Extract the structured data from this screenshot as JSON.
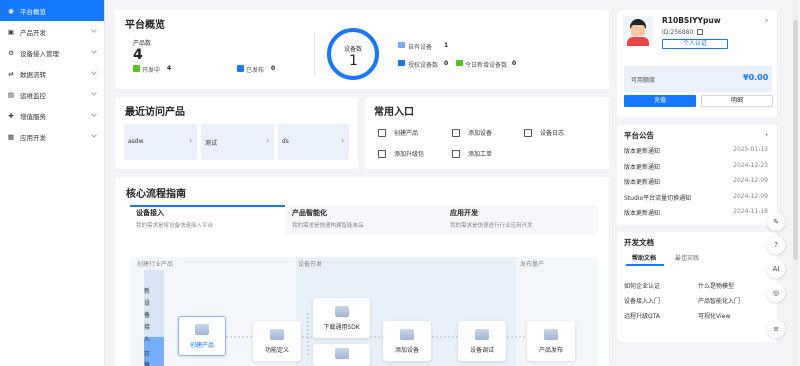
{
  "sidebar": {
    "items": [
      {
        "label": "平台概览",
        "active": true,
        "icon": "home-icon"
      },
      {
        "label": "产品开发",
        "icon": "product-icon"
      },
      {
        "label": "设备接入管理",
        "icon": "device-icon"
      },
      {
        "label": "数据流转",
        "icon": "data-flow-icon"
      },
      {
        "label": "运维监控",
        "icon": "monitor-icon"
      },
      {
        "label": "增值服务",
        "icon": "service-icon"
      },
      {
        "label": "应用开发",
        "icon": "app-icon"
      }
    ]
  },
  "overview": {
    "title": "平台概览",
    "product_count_label": "产品数",
    "product_count": "4",
    "developing_label": "开发中",
    "developing_count": "4",
    "published_label": "已发布",
    "published_count": "0",
    "device_count_label": "设备数",
    "device_count": "1",
    "own_devices_label": "自有设备",
    "own_devices": "1",
    "authorized_label": "授权设备数",
    "authorized": "0",
    "new_today_label": "今日新增设备数",
    "new_today": "0"
  },
  "account": {
    "username": "R10BSIYYpuw",
    "id_text": "ID:256880",
    "personal_cert": "个人认证",
    "quota_label": "可用额度",
    "quota": "¥0.00",
    "recharge": "充值",
    "details": "明细"
  },
  "recent": {
    "title": "最近访问产品",
    "items": [
      "asdw",
      "测试",
      "ds"
    ]
  },
  "shortcuts": {
    "title": "常用入口",
    "items": [
      "创建产品",
      "添加设备",
      "设备日志",
      "添加升级包",
      "添加工单"
    ]
  },
  "announcements": {
    "title": "平台公告",
    "items": [
      {
        "text": "版本更新通知",
        "date": "2025-01-13"
      },
      {
        "text": "版本更新通知",
        "date": "2024-12-23"
      },
      {
        "text": "版本更新通知",
        "date": "2024-12-09"
      },
      {
        "text": "Studio平台流量切换通知",
        "date": "2024-12-09"
      },
      {
        "text": "版本更新通知",
        "date": "2024-11-18"
      }
    ]
  },
  "docs": {
    "title": "开发文档",
    "tabs": [
      "帮助文档",
      "最佳实践"
    ],
    "links": [
      "如何企业认证",
      "什么是物模型",
      "设备接入入门",
      "产品智能化入门",
      "远程升级OTA",
      "可视化View"
    ]
  },
  "guide": {
    "title": "核心流程指南",
    "tabs": [
      {
        "label": "设备接入",
        "sub": "我的需求是将设备快速接入平台"
      },
      {
        "label": "产品智能化",
        "sub": "我的需求是快速构建智能单品"
      },
      {
        "label": "应用开发",
        "sub": "我的需求是快速进行行业应用开发"
      }
    ],
    "stages": [
      "创建行业产品",
      "设备开发",
      "发布量产"
    ],
    "vertical_label": "新设备接入",
    "vertical_label2": "存量",
    "nodes": [
      "创建产品",
      "功能定义",
      "下载通用SDK",
      "添加设备",
      "设备调试",
      "产品发布"
    ]
  },
  "float": [
    "AI"
  ],
  "colors": {
    "accent": "#1677ff",
    "green": "#52c41a"
  }
}
